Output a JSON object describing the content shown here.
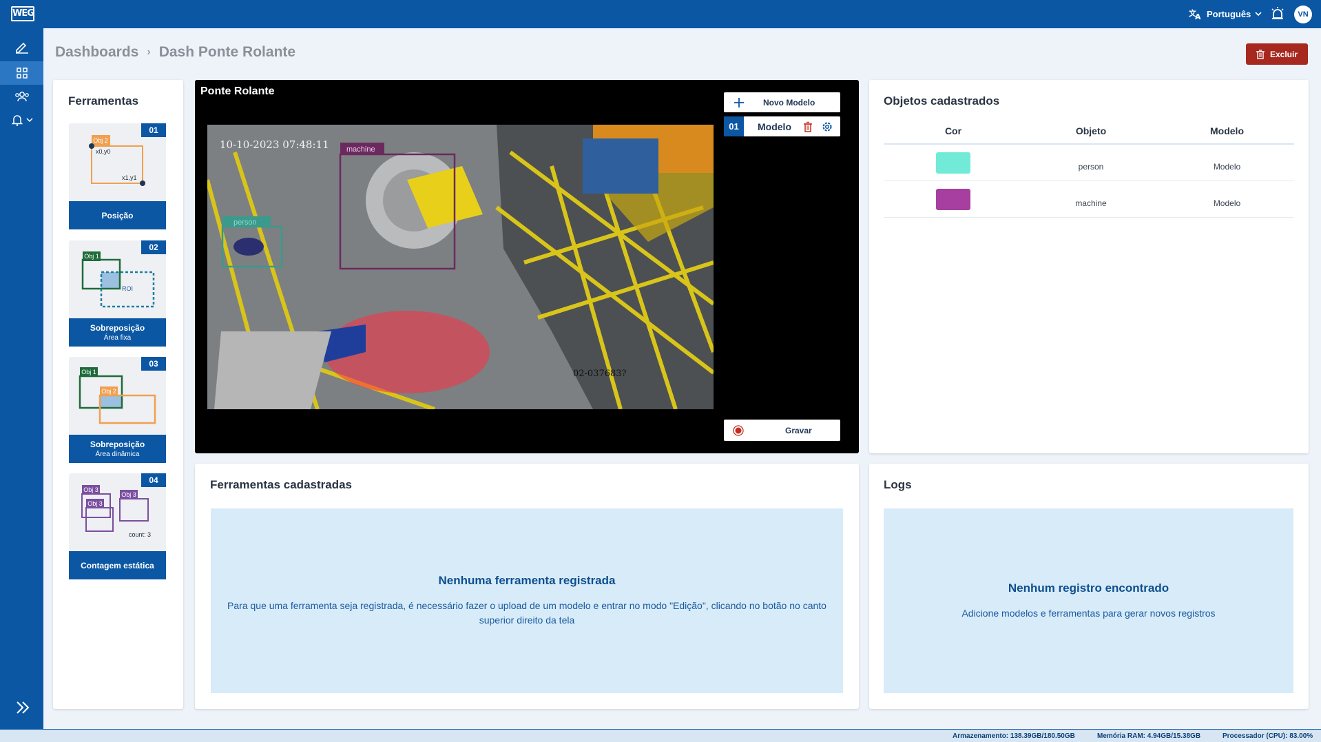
{
  "header": {
    "logo_text": "WEG",
    "language": "Português",
    "user_initials": "VN"
  },
  "breadcrumb": [
    "Dashboards",
    "Dash Ponte Rolante"
  ],
  "actions": {
    "delete_label": "Excluir"
  },
  "tools_panel": {
    "title": "Ferramentas",
    "items": [
      {
        "number": "01",
        "label": "Posição",
        "sublabel": "",
        "fig": {
          "obj": "Obj 2",
          "p0": "x0,y0",
          "p1": "x1,y1"
        }
      },
      {
        "number": "02",
        "label": "Sobreposição",
        "sublabel": "Área fixa",
        "fig": {
          "obj": "Obj 1",
          "roi": "ROI"
        }
      },
      {
        "number": "03",
        "label": "Sobreposição",
        "sublabel": "Área dinâmica",
        "fig": {
          "obj_a": "Obj 1",
          "obj_b": "Obj 2"
        }
      },
      {
        "number": "04",
        "label": "Contagem estática",
        "sublabel": "",
        "fig": {
          "obj_a": "Obj 3",
          "obj_b": "Obj 3",
          "obj_c": "Obj 3",
          "count": "count: 3"
        }
      }
    ]
  },
  "video": {
    "title": "Ponte Rolante",
    "timestamp": "10-10-2023 07:48:11",
    "camera_id": "02-037683?",
    "detections": [
      {
        "label": "machine",
        "color": "#6b2a5e"
      },
      {
        "label": "person",
        "color": "#3a9a8c"
      }
    ],
    "new_model_label": "Novo Modelo",
    "model": {
      "number": "01",
      "name": "Modelo"
    },
    "record_label": "Gravar"
  },
  "objects_panel": {
    "title": "Objetos cadastrados",
    "columns": [
      "Cor",
      "Objeto",
      "Modelo"
    ],
    "rows": [
      {
        "color": "#72ead8",
        "object": "person",
        "model": "Modelo"
      },
      {
        "color": "#a63fa0",
        "object": "machine",
        "model": "Modelo"
      }
    ]
  },
  "registered_tools": {
    "title": "Ferramentas cadastradas",
    "empty_title": "Nenhuma ferramenta registrada",
    "empty_text": "Para que uma ferramenta seja registrada, é necessário fazer o upload de um modelo e entrar no modo \"Edição\", clicando no botão no canto superior direito da tela"
  },
  "logs": {
    "title": "Logs",
    "empty_title": "Nenhum registro encontrado",
    "empty_text": "Adicione modelos e ferramentas para gerar novos registros"
  },
  "status": {
    "storage": "Armazenamento: 138.39GB/180.50GB",
    "ram": "Memória RAM: 4.94GB/15.38GB",
    "cpu": "Processador (CPU): 83.00%"
  },
  "colors": {
    "brand": "#0b57a4",
    "danger": "#a7281f"
  }
}
